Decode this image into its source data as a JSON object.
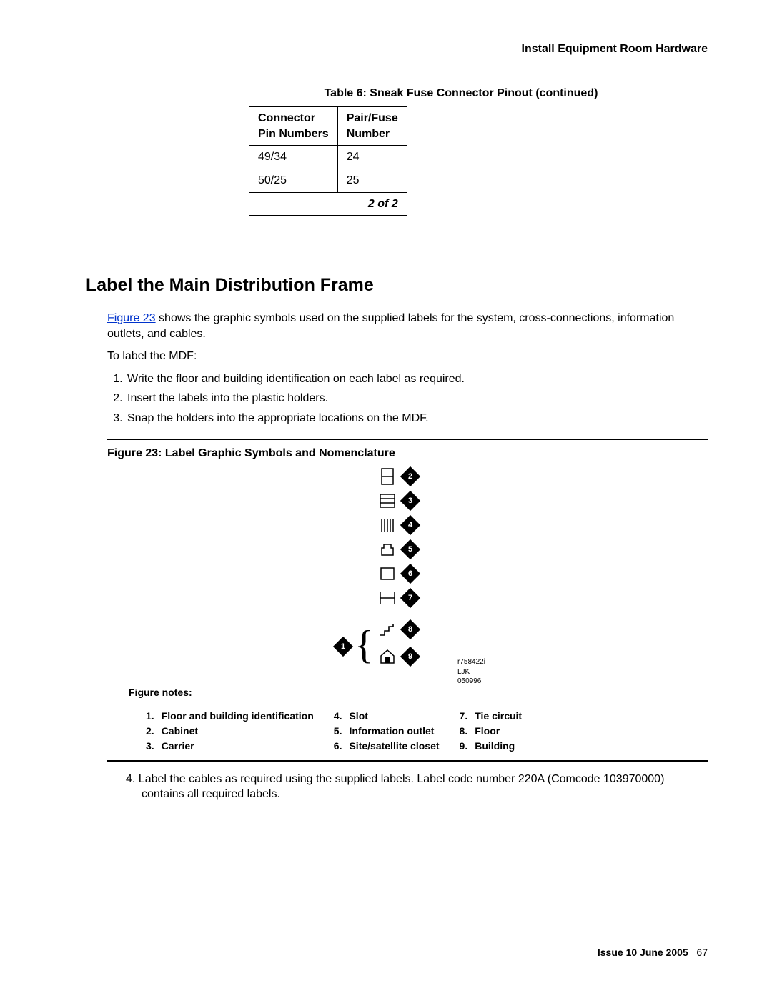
{
  "running_head": "Install Equipment Room Hardware",
  "table": {
    "title": "Table 6: Sneak Fuse Connector Pinout  (continued)",
    "headers": {
      "col1_a": "Connector",
      "col1_b": "Pin Numbers",
      "col2_a": "Pair/Fuse",
      "col2_b": "Number"
    },
    "rows": [
      {
        "c1": "49/34",
        "c2": "24"
      },
      {
        "c1": "50/25",
        "c2": "25"
      }
    ],
    "pager": "2 of 2"
  },
  "section": {
    "heading": "Label the Main Distribution Frame",
    "para_link": "Figure 23",
    "para_rest": " shows the graphic symbols used on the supplied labels for the system, cross-connections, information outlets, and cables.",
    "lead": "To label the MDF:",
    "steps": [
      "Write the floor and building identification on each label as required.",
      "Insert the labels into the plastic holders.",
      "Snap the holders into the appropriate locations on the MDF."
    ],
    "step4": "4. Label the cables as required using the supplied labels. Label code number 220A (Comcode 103970000) contains all required labels."
  },
  "figure": {
    "title": "Figure 23: Label Graphic Symbols and Nomenclature",
    "caption_id": "r758422i LJK 050996",
    "notes_label": "Figure notes:",
    "notes_cols": [
      [
        {
          "n": "1.",
          "t": "Floor and building identification"
        },
        {
          "n": "2.",
          "t": "Cabinet"
        },
        {
          "n": "3.",
          "t": "Carrier"
        }
      ],
      [
        {
          "n": "4.",
          "t": "Slot"
        },
        {
          "n": "5.",
          "t": "Information outlet"
        },
        {
          "n": "6.",
          "t": "Site/satellite closet"
        }
      ],
      [
        {
          "n": "7.",
          "t": "Tie circuit"
        },
        {
          "n": "8.",
          "t": "Floor"
        },
        {
          "n": "9.",
          "t": "Building"
        }
      ]
    ]
  },
  "footer": {
    "issue": "Issue 10    June 2005",
    "page": "67"
  }
}
